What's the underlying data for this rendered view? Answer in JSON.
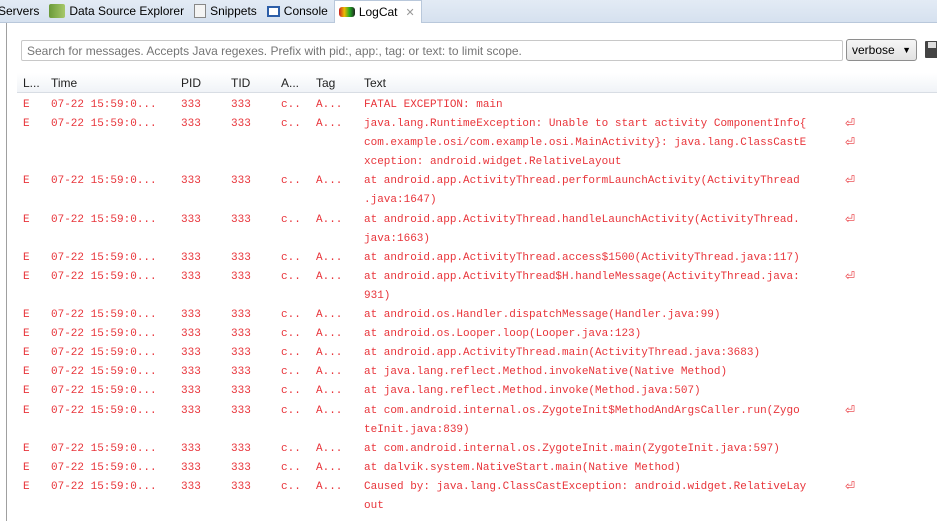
{
  "tabs": [
    {
      "label": "Servers",
      "icon": "servers-icon"
    },
    {
      "label": "Data Source Explorer",
      "icon": "data-source-icon"
    },
    {
      "label": "Snippets",
      "icon": "snippets-icon"
    },
    {
      "label": "Console",
      "icon": "console-icon"
    },
    {
      "label": "LogCat",
      "icon": "logcat-icon",
      "active": true
    }
  ],
  "search": {
    "placeholder": "Search for messages. Accepts Java regexes. Prefix with pid:, app:, tag: or text: to limit scope.",
    "value": ""
  },
  "level_select": {
    "value": "verbose"
  },
  "columns": {
    "level": "L...",
    "time": "Time",
    "pid": "PID",
    "tid": "TID",
    "app": "A...",
    "tag": "Tag",
    "text": "Text"
  },
  "colors": {
    "error": "#e8343a"
  },
  "entries": [
    {
      "level": "E",
      "time": "07-22 15:59:0...",
      "pid": "333",
      "tid": "333",
      "app": "c..",
      "tag": "A...",
      "lines": [
        "FATAL EXCEPTION: main"
      ]
    },
    {
      "level": "E",
      "time": "07-22 15:59:0...",
      "pid": "333",
      "tid": "333",
      "app": "c..",
      "tag": "A...",
      "lines": [
        "java.lang.RuntimeException: Unable to start activity ComponentInfo{",
        "com.example.osi/com.example.osi.MainActivity}: java.lang.ClassCastE",
        "xception: android.widget.RelativeLayout"
      ]
    },
    {
      "level": "E",
      "time": "07-22 15:59:0...",
      "pid": "333",
      "tid": "333",
      "app": "c..",
      "tag": "A...",
      "lines": [
        "at android.app.ActivityThread.performLaunchActivity(ActivityThread",
        ".java:1647)"
      ]
    },
    {
      "level": "E",
      "time": "07-22 15:59:0...",
      "pid": "333",
      "tid": "333",
      "app": "c..",
      "tag": "A...",
      "lines": [
        "at android.app.ActivityThread.handleLaunchActivity(ActivityThread.",
        "java:1663)"
      ]
    },
    {
      "level": "E",
      "time": "07-22 15:59:0...",
      "pid": "333",
      "tid": "333",
      "app": "c..",
      "tag": "A...",
      "lines": [
        "at android.app.ActivityThread.access$1500(ActivityThread.java:117)"
      ]
    },
    {
      "level": "E",
      "time": "07-22 15:59:0...",
      "pid": "333",
      "tid": "333",
      "app": "c..",
      "tag": "A...",
      "lines": [
        "at android.app.ActivityThread$H.handleMessage(ActivityThread.java:",
        "931)"
      ]
    },
    {
      "level": "E",
      "time": "07-22 15:59:0...",
      "pid": "333",
      "tid": "333",
      "app": "c..",
      "tag": "A...",
      "lines": [
        "at android.os.Handler.dispatchMessage(Handler.java:99)"
      ]
    },
    {
      "level": "E",
      "time": "07-22 15:59:0...",
      "pid": "333",
      "tid": "333",
      "app": "c..",
      "tag": "A...",
      "lines": [
        "at android.os.Looper.loop(Looper.java:123)"
      ]
    },
    {
      "level": "E",
      "time": "07-22 15:59:0...",
      "pid": "333",
      "tid": "333",
      "app": "c..",
      "tag": "A...",
      "lines": [
        "at android.app.ActivityThread.main(ActivityThread.java:3683)"
      ]
    },
    {
      "level": "E",
      "time": "07-22 15:59:0...",
      "pid": "333",
      "tid": "333",
      "app": "c..",
      "tag": "A...",
      "lines": [
        "at java.lang.reflect.Method.invokeNative(Native Method)"
      ]
    },
    {
      "level": "E",
      "time": "07-22 15:59:0...",
      "pid": "333",
      "tid": "333",
      "app": "c..",
      "tag": "A...",
      "lines": [
        "at java.lang.reflect.Method.invoke(Method.java:507)"
      ]
    },
    {
      "level": "E",
      "time": "07-22 15:59:0...",
      "pid": "333",
      "tid": "333",
      "app": "c..",
      "tag": "A...",
      "lines": [
        "at com.android.internal.os.ZygoteInit$MethodAndArgsCaller.run(Zygo",
        "teInit.java:839)"
      ]
    },
    {
      "level": "E",
      "time": "07-22 15:59:0...",
      "pid": "333",
      "tid": "333",
      "app": "c..",
      "tag": "A...",
      "lines": [
        "at com.android.internal.os.ZygoteInit.main(ZygoteInit.java:597)"
      ]
    },
    {
      "level": "E",
      "time": "07-22 15:59:0...",
      "pid": "333",
      "tid": "333",
      "app": "c..",
      "tag": "A...",
      "lines": [
        "at dalvik.system.NativeStart.main(Native Method)"
      ]
    },
    {
      "level": "E",
      "time": "07-22 15:59:0...",
      "pid": "333",
      "tid": "333",
      "app": "c..",
      "tag": "A...",
      "lines": [
        "Caused by: java.lang.ClassCastException: android.widget.RelativeLay",
        "out"
      ]
    }
  ]
}
